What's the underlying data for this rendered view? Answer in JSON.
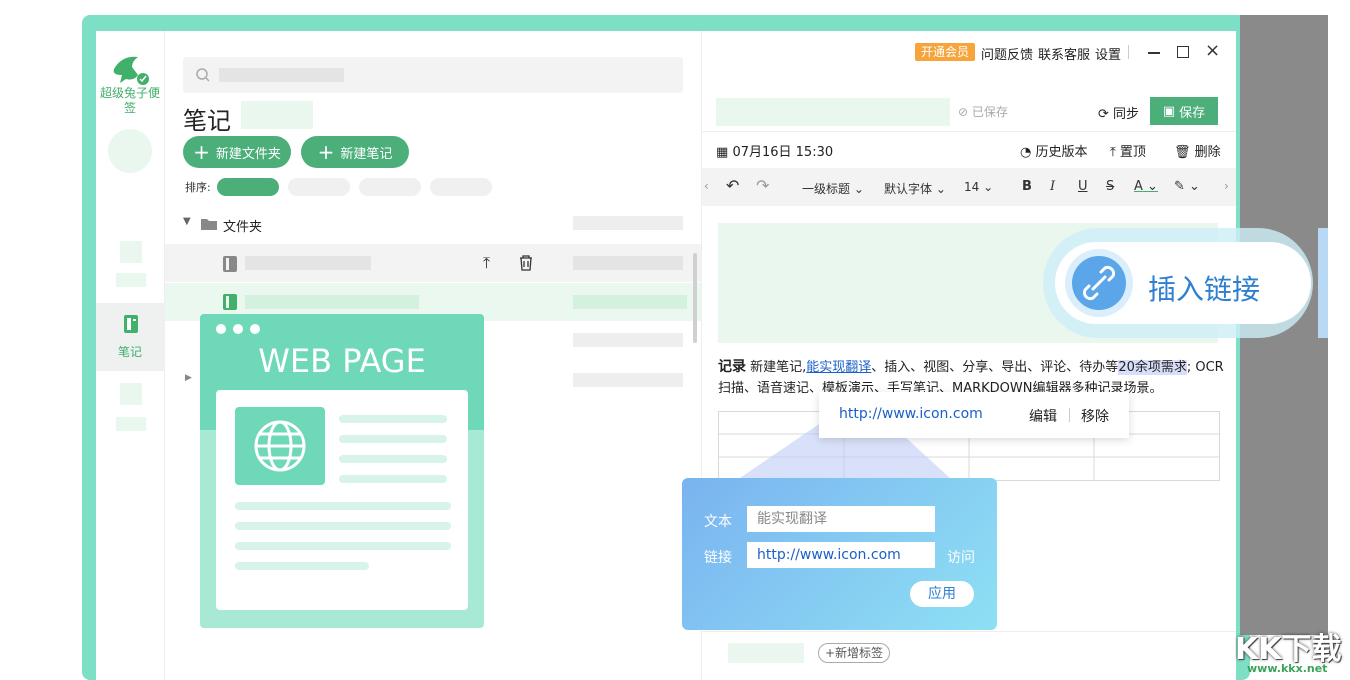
{
  "sidebar": {
    "app_name": "超级兔子便签",
    "nav_notes": "笔记"
  },
  "middle": {
    "title": "笔记",
    "new_folder": "新建文件夹",
    "new_note": "新建笔记",
    "sort_label": "排序:",
    "folder_label": "文件夹"
  },
  "editor": {
    "vip": "开通会员",
    "feedback": "问题反馈",
    "support": "联系客服",
    "settings": "设置",
    "saved_status": "已保存",
    "sync": "同步",
    "save": "保存",
    "datetime": "07月16日 15:30",
    "history": "历史版本",
    "pin": "置顶",
    "delete": "删除",
    "toolbar": {
      "heading": "一级标题",
      "font": "默认字体",
      "size": "14",
      "bold": "B",
      "italic": "I",
      "underline": "U",
      "strike": "S",
      "color": "A"
    },
    "body": {
      "lead": "记录",
      "t1": "新建笔记,",
      "link": "能实现翻译",
      "t2": "、插入、视图、分享、导出、评论、待办等",
      "highlight": "20余项需求",
      "t3": "; OCR扫描、语音速记、模板演示、手写笔记、MARKDOWN编辑器多种记录场景。"
    },
    "add_tag": "+新增标签"
  },
  "link_tip": {
    "url": "http://www.icon.com",
    "edit": "编辑",
    "remove": "移除"
  },
  "link_dialog": {
    "text_label": "文本",
    "text_value": "能实现翻译",
    "link_label": "链接",
    "link_value": "http://www.icon.com",
    "visit": "访问",
    "apply": "应用"
  },
  "overlay": {
    "web_page": "WEB PAGE",
    "insert_link": "插入链接"
  },
  "watermark": {
    "main": "KK下载",
    "sub": "www.kkx.net"
  },
  "colors": {
    "brand_green": "#4caf7a",
    "frame": "#7ddfc6",
    "vip_orange": "#f6a53c",
    "link_blue": "#1a5fc8"
  }
}
